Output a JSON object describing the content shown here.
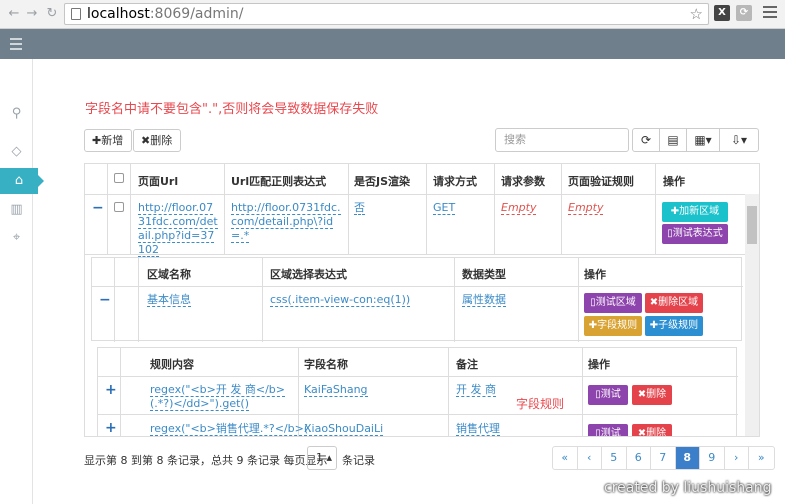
{
  "browser": {
    "url_host": "localhost",
    "url_rest": ":8069/admin/"
  },
  "warning": "字段名中请不要包含\".\",否则将会导致数据保存失败",
  "toolbar": {
    "add_label": "✚新增",
    "delete_label": "✖删除",
    "search_placeholder": "搜索"
  },
  "main_table": {
    "headers": [
      "页面Url",
      "Url匹配正则表达式",
      "是否JS渲染",
      "请求方式",
      "请求参数",
      "页面验证规则",
      "操作"
    ],
    "row": {
      "page_url": "http://floor.0731fdc.com/detail.php?id=37102",
      "url_regex": "http://floor.0731fdc.com/detail.php\\?id=.*",
      "js_render": "否",
      "method": "GET",
      "params": "Empty",
      "validation": "Empty",
      "btn_add_region": "✚加新区域",
      "btn_test_expr": "▯测试表达式"
    }
  },
  "region_table": {
    "headers": [
      "区域名称",
      "区域选择表达式",
      "数据类型",
      "操作"
    ],
    "row": {
      "name": "基本信息",
      "selector": "css(.item-view-con:eq(1))",
      "data_type": "属性数据",
      "btn_test_region": "▯测试区域",
      "btn_delete_region": "✖删除区域",
      "btn_field_rule": "✚字段规则",
      "btn_child_rule": "✚子级规则"
    }
  },
  "rule_table": {
    "headers": [
      "规则内容",
      "字段名称",
      "备注",
      "操作"
    ],
    "rows": [
      {
        "content": "regex(\"<b>开 发 商</b>(.*?)</dd>\").get()",
        "field": "KaiFaShang",
        "note": "开 发 商",
        "btn_test": "▯测试",
        "btn_delete": "✖删除"
      },
      {
        "content": "regex(\"<b>销售代理.*?</b>(.",
        "field": "XiaoShouDaiLi",
        "note": "销售代理",
        "btn_test": "▯测试",
        "btn_delete": "✖删除"
      }
    ],
    "annotation": "字段规则"
  },
  "footer": {
    "info_before": "显示第 8 到第 8 条记录，总共 9 条记录 每页显示",
    "page_size": "1",
    "info_after": "条记录",
    "pages": [
      "«",
      "‹",
      "5",
      "6",
      "7",
      "8",
      "9",
      "›",
      "»"
    ],
    "active_page": "8"
  },
  "watermark": "created by liushuishang",
  "colors": {
    "topbar": "#6f7f8c",
    "accent": "#36b0c2",
    "warning": "#e8494f",
    "link": "#3b8bc7"
  }
}
